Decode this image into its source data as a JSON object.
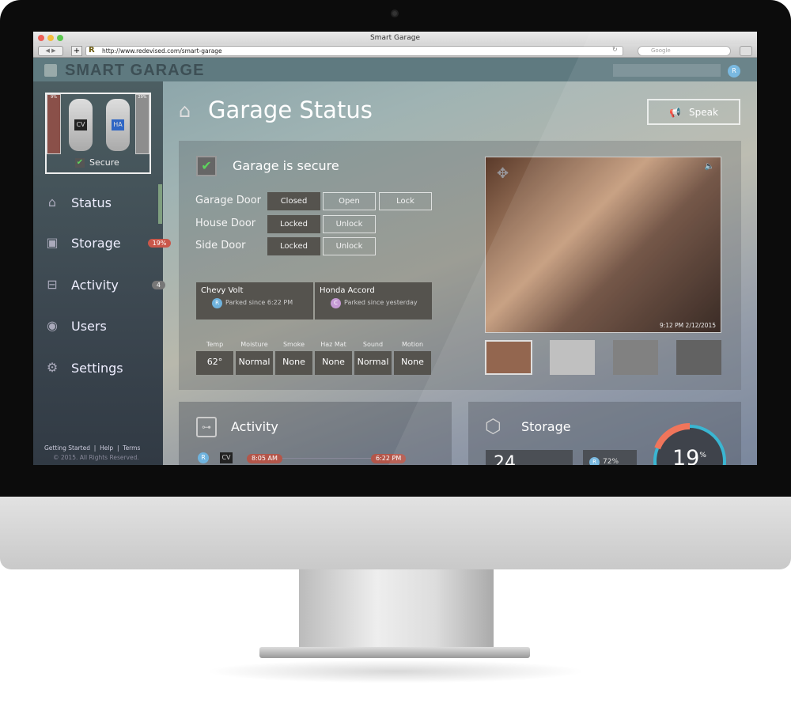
{
  "browser": {
    "title": "Smart Garage",
    "url": "http://www.redevised.com/smart-garage",
    "search_placeholder": "Google"
  },
  "app": {
    "logo": "SMART GARAGE",
    "user_initial": "R"
  },
  "garage_map": {
    "left_percent": "9%",
    "right_percent": "29%",
    "car_left": "CV",
    "car_right": "HA",
    "secure_label": "Secure"
  },
  "sidebar": {
    "items": [
      {
        "label": "Status",
        "icon": "house-icon"
      },
      {
        "label": "Storage",
        "icon": "box-icon",
        "badge": "19%"
      },
      {
        "label": "Activity",
        "icon": "activity-icon",
        "badge": "4"
      },
      {
        "label": "Users",
        "icon": "user-icon"
      },
      {
        "label": "Settings",
        "icon": "gear-icon"
      }
    ],
    "footer": {
      "links": [
        "Getting Started",
        "Help",
        "Terms"
      ],
      "copyright": "© 2015. All Rights Reserved."
    }
  },
  "main": {
    "title": "Garage Status",
    "speak_label": "Speak",
    "secure_text": "Garage is secure",
    "doors": [
      {
        "label": "Garage Door",
        "state": "Closed",
        "actions": [
          "Open",
          "Lock"
        ]
      },
      {
        "label": "House Door",
        "state": "Locked",
        "actions": [
          "Unlock"
        ]
      },
      {
        "label": "Side Door",
        "state": "Locked",
        "actions": [
          "Unlock"
        ]
      }
    ],
    "cars": [
      {
        "name": "Chevy Volt",
        "user": "R",
        "status": "Parked since 6:22 PM"
      },
      {
        "name": "Honda Accord",
        "user": "C",
        "status": "Parked since yesterday"
      }
    ],
    "sensors": [
      {
        "label": "Temp",
        "value": "62°"
      },
      {
        "label": "Moisture",
        "value": "Normal"
      },
      {
        "label": "Smoke",
        "value": "None"
      },
      {
        "label": "Haz Mat",
        "value": "None"
      },
      {
        "label": "Sound",
        "value": "Normal"
      },
      {
        "label": "Motion",
        "value": "None"
      }
    ],
    "camera": {
      "timestamp": "9:12 PM  2/12/2015"
    }
  },
  "activity": {
    "title": "Activity",
    "user": "R",
    "car": "CV",
    "start": "8:05 AM",
    "end": "6:22 PM"
  },
  "storage": {
    "title": "Storage",
    "big_value": "24",
    "user": "R",
    "user_percent": "72%",
    "gauge_value": "19",
    "gauge_unit": "%",
    "gauge_fraction": 0.19,
    "colors": {
      "used": "#ef6a4e",
      "ring": "#2ab0cf"
    }
  }
}
